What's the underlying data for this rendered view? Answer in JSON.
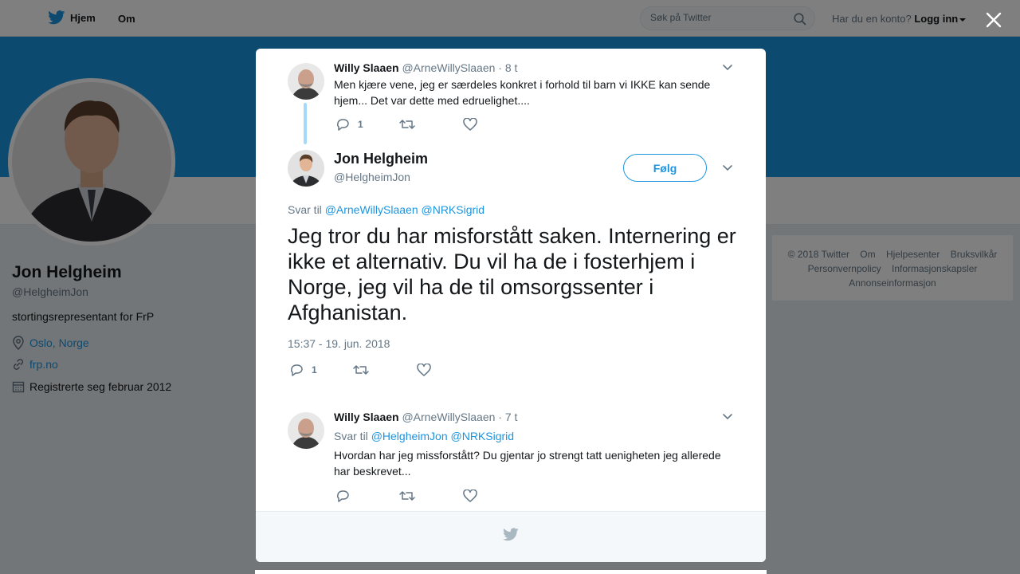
{
  "nav": {
    "home_label": "Hjem",
    "about_label": "Om",
    "search_placeholder": "Søk på Twitter",
    "account_question": "Har du en konto?",
    "login_label": "Logg inn"
  },
  "profile": {
    "name": "Jon Helgheim",
    "handle": "@HelgheimJon",
    "bio": "stortingsrepresentant for FrP",
    "location": "Oslo, Norge",
    "website": "frp.no",
    "joined": "Registrerte seg februar 2012"
  },
  "footer": {
    "links": [
      "© 2018 Twitter",
      "Om",
      "Hjelpesenter",
      "Bruksvilkår",
      "Personvernpolicy",
      "Informasjonskapsler",
      "Annonseinformasjon"
    ]
  },
  "modal": {
    "parent_tweet": {
      "name": "Willy Slaaen",
      "handle": "@ArneWillySlaaen",
      "time": "· 8 t",
      "text": "Men kjære vene, jeg er særdeles konkret i forhold til barn vi IKKE kan sende hjem... Det var dette med edruelighet....",
      "reply_count": "1"
    },
    "main_tweet": {
      "name": "Jon Helgheim",
      "handle": "@HelgheimJon",
      "follow_label": "Følg",
      "reply_prefix": "Svar til",
      "reply_to_1": "@ArneWillySlaaen",
      "reply_to_2": "@NRKSigrid",
      "text": "Jeg tror du har misforstått saken. Internering er ikke et alternativ. Du vil ha de i fosterhjem i Norge, jeg vil ha de til omsorgssenter i Afghanistan.",
      "timestamp": "15:37 - 19. jun. 2018",
      "reply_count": "1"
    },
    "reply_tweet": {
      "name": "Willy Slaaen",
      "handle": "@ArneWillySlaaen",
      "time": "· 7 t",
      "reply_prefix": "Svar til",
      "reply_to_1": "@HelgheimJon",
      "reply_to_2": "@NRKSigrid",
      "text": "Hvordan har jeg missforstått? Du gjentar jo strengt tatt uenigheten jeg allerede har beskrevet..."
    }
  },
  "colors": {
    "accent": "#1b95e0",
    "thread_line": "#a4d9f9",
    "muted_text": "#657786"
  }
}
